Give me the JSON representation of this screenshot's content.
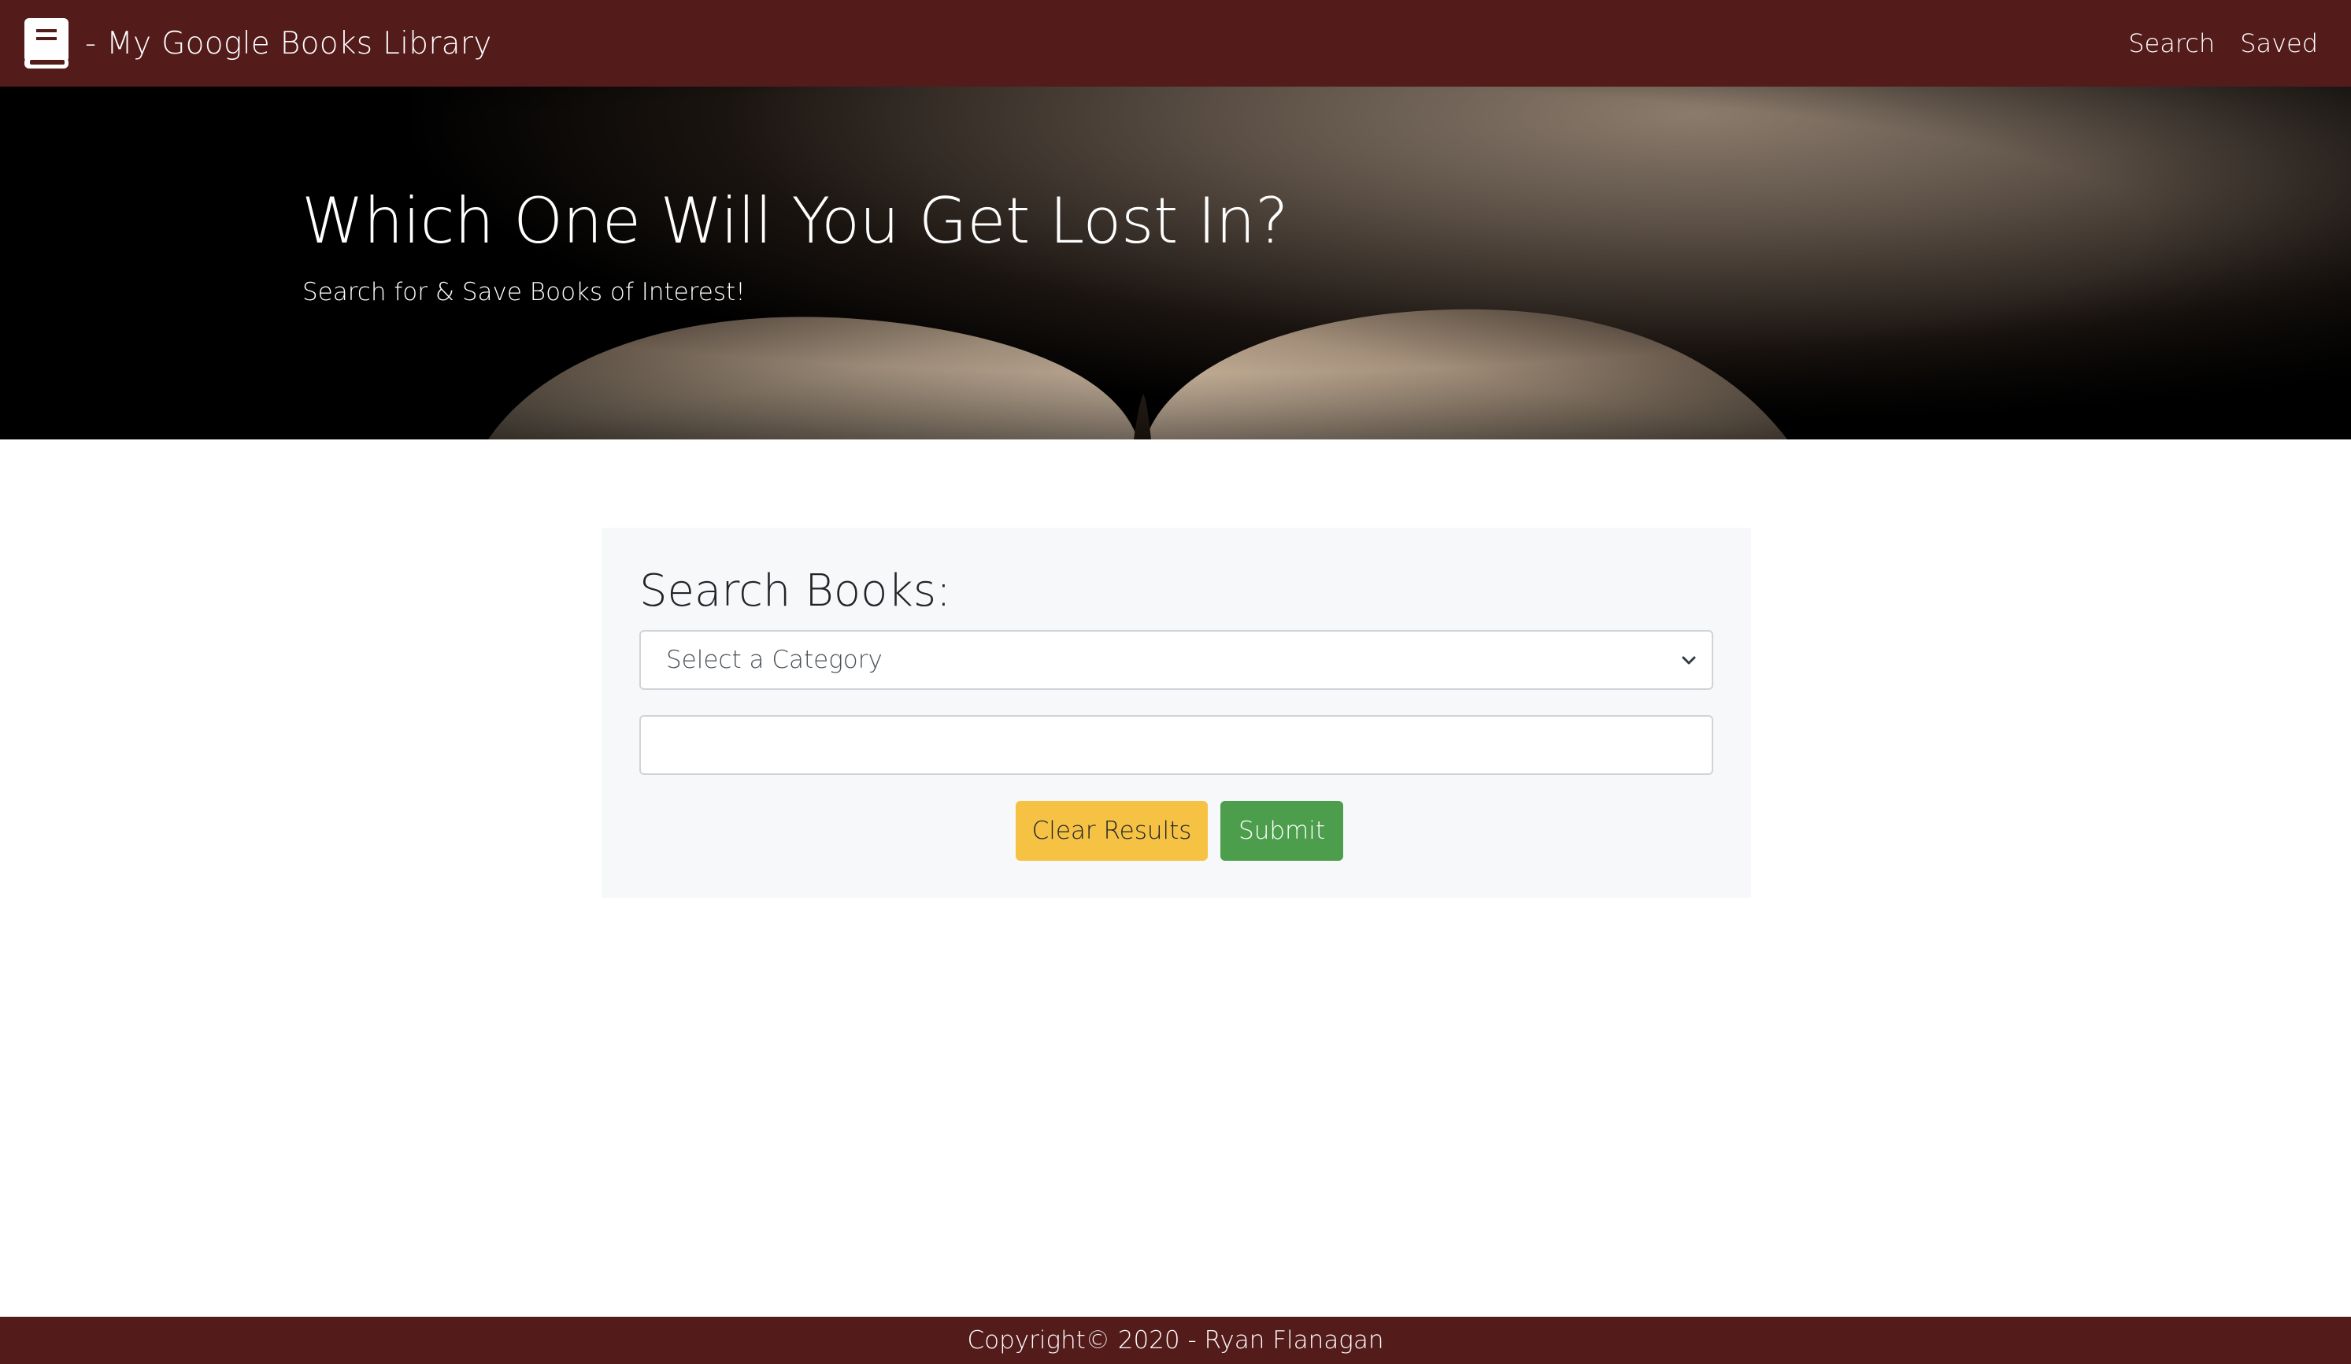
{
  "navbar": {
    "brand_icon": "book-icon",
    "brand_text": "- My Google Books Library",
    "links": [
      {
        "label": "Search"
      },
      {
        "label": "Saved"
      }
    ],
    "background_color": "#541b1b"
  },
  "hero": {
    "title": "Which One Will You Get Lost In?",
    "subtitle": "Search for & Save Books of Interest!",
    "background_image": "open-book-photo"
  },
  "search": {
    "heading": "Search Books:",
    "category_select": {
      "selected": "Select a Category",
      "icon": "chevron-down-icon"
    },
    "query_input": {
      "value": "",
      "placeholder": ""
    },
    "buttons": {
      "clear_label": "Clear Results",
      "submit_label": "Submit"
    },
    "colors": {
      "clear_button": "#f6c244",
      "submit_button": "#4c9e4c"
    }
  },
  "footer": {
    "text": "Copyright© 2020 - Ryan Flanagan"
  }
}
